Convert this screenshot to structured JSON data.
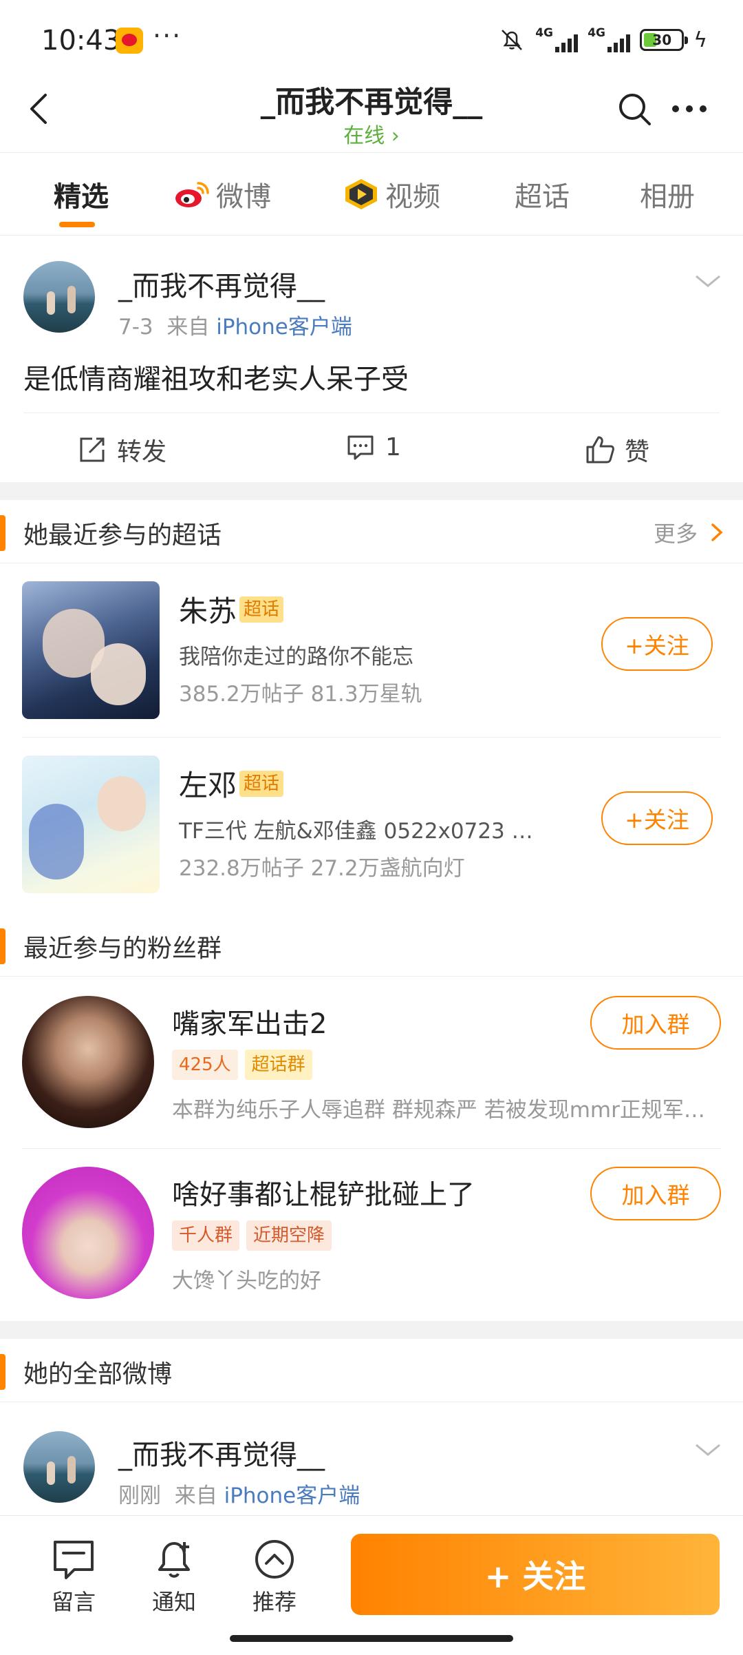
{
  "status_bar": {
    "time": "10:43",
    "more_dots": "···",
    "network1": "4G",
    "network2": "4G",
    "battery": "30"
  },
  "nav": {
    "title": "_而我不再觉得__",
    "status": "在线 ›"
  },
  "tabs": [
    {
      "label": "精选"
    },
    {
      "label": "微博"
    },
    {
      "label": "视频"
    },
    {
      "label": "超话"
    },
    {
      "label": "相册"
    }
  ],
  "post": {
    "author": "_而我不再觉得__",
    "date": "7-3",
    "from_prefix": "来自",
    "source": "iPhone客户端",
    "text": "是低情商耀祖攻和老实人呆子受",
    "actions": {
      "repost": "转发",
      "comment_count": "1",
      "like": "赞"
    }
  },
  "supertopics": {
    "header": "她最近参与的超话",
    "more": "更多",
    "items": [
      {
        "name": "朱苏",
        "tag": "超话",
        "desc": "我陪你走过的路你不能忘",
        "stats": "385.2万帖子 81.3万星轨",
        "follow": "+关注"
      },
      {
        "name": "左邓",
        "tag": "超话",
        "desc": "TF三代  左航&邓佳鑫    0522x0723  …",
        "stats": "232.8万帖子 27.2万盏航向灯",
        "follow": "+关注"
      }
    ]
  },
  "fan_groups": {
    "header": "最近参与的粉丝群",
    "items": [
      {
        "name": "嘴家军出击2",
        "tags": [
          "425人",
          "超话群"
        ],
        "desc": "本群为纯乐子人辱追群 群规森严 若被发现mmr正规军…",
        "join": "加入群"
      },
      {
        "name": "啥好事都让棍铲批碰上了",
        "tags": [
          "千人群",
          "近期空降"
        ],
        "desc": "大馋丫头吃的好",
        "join": "加入群"
      }
    ]
  },
  "all_weibo": {
    "header": "她的全部微博",
    "author": "_而我不再觉得__",
    "time": "刚刚",
    "from_prefix": "来自",
    "source": "iPhone客户端"
  },
  "bottom_bar": {
    "message": "留言",
    "notify": "通知",
    "recommend": "推荐",
    "follow": "+ 关注"
  },
  "colors": {
    "accent": "#ff8200",
    "online": "#5bb13c",
    "link": "#4a7bbf"
  }
}
